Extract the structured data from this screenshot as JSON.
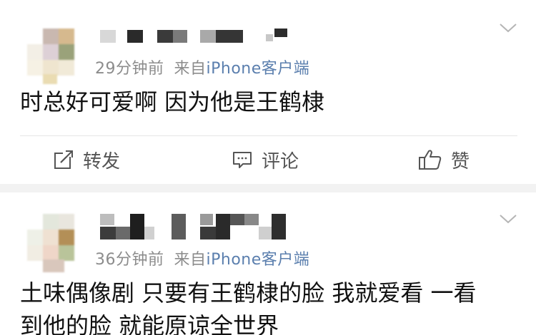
{
  "posts": [
    {
      "time": "29分钟前",
      "source_prefix": "来自",
      "source_app": "iPhone客户端",
      "text": "时总好可爱啊 因为他是王鹤棣"
    },
    {
      "time": "36分钟前",
      "source_prefix": "来自",
      "source_app": "iPhone客户端",
      "text": "土味偶像剧 只要有王鹤棣的脸 我就爱看 一看\n到他的脸 就能原谅全世界"
    }
  ],
  "actions": {
    "repost": "转发",
    "comment": "评论",
    "like": "赞"
  },
  "icons": {
    "repost": "share-edit-icon",
    "comment": "comment-bubble-icon",
    "like": "thumbs-up-icon",
    "more": "chevron-down-icon"
  },
  "colors": {
    "meta": "#8c8c8c",
    "app_link": "#5b7fae",
    "action": "#555555",
    "separator": "#f2f2f2"
  }
}
